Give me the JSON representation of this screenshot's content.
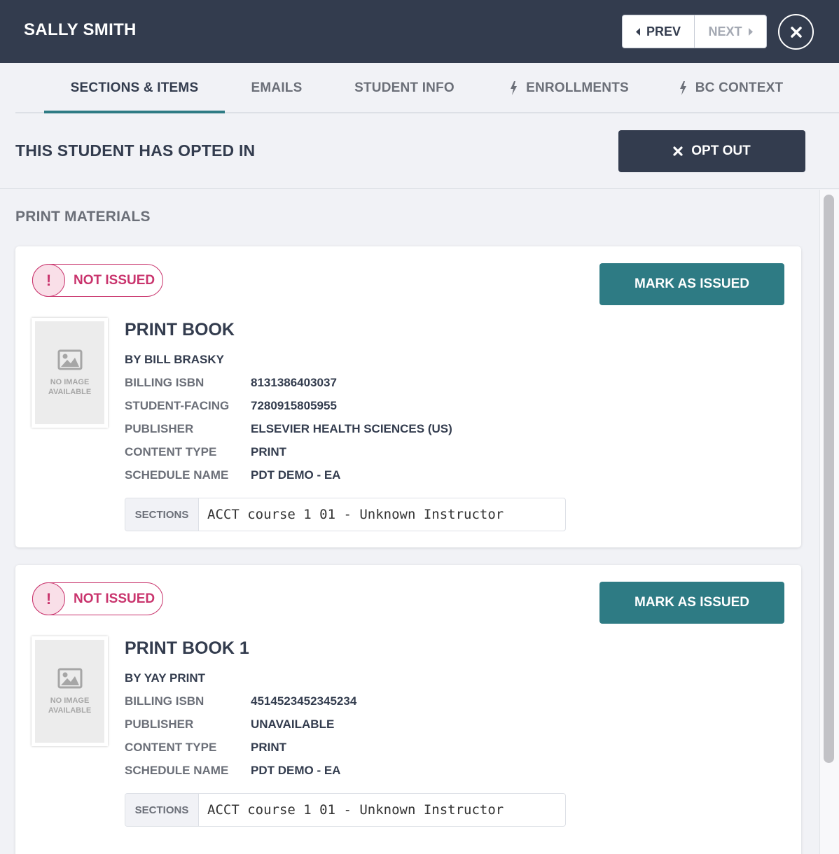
{
  "header": {
    "student_name": "SALLY SMITH",
    "prev_label": "PREV",
    "next_label": "NEXT"
  },
  "tabs": [
    {
      "label": "SECTIONS & ITEMS",
      "active": true
    },
    {
      "label": "EMAILS"
    },
    {
      "label": "STUDENT INFO"
    },
    {
      "label": "ENROLLMENTS",
      "icon": "lightning-icon"
    },
    {
      "label": "BC CONTEXT",
      "icon": "lightning-icon"
    }
  ],
  "opt_status": {
    "message": "THIS STUDENT HAS OPTED IN",
    "button_label": "OPT OUT"
  },
  "print_materials": {
    "title": "PRINT MATERIALS",
    "items": [
      {
        "status": "NOT ISSUED",
        "status_icon": "!",
        "action_label": "MARK AS ISSUED",
        "no_image_text": "NO IMAGE AVAILABLE",
        "title": "PRINT BOOK",
        "author": "BY BILL BRASKY",
        "details": [
          {
            "label": "BILLING ISBN",
            "value": "8131386403037"
          },
          {
            "label": "STUDENT-FACING",
            "value": "7280915805955"
          },
          {
            "label": "PUBLISHER",
            "value": "ELSEVIER HEALTH SCIENCES (US)"
          },
          {
            "label": "CONTENT TYPE",
            "value": "PRINT"
          },
          {
            "label": "SCHEDULE NAME",
            "value": "PDT DEMO - EA"
          }
        ],
        "sections_label": "SECTIONS",
        "sections_value": "ACCT course 1 01 - Unknown Instructor"
      },
      {
        "status": "NOT ISSUED",
        "status_icon": "!",
        "action_label": "MARK AS ISSUED",
        "no_image_text": "NO IMAGE AVAILABLE",
        "title": "PRINT BOOK 1",
        "author": "BY YAY PRINT",
        "details": [
          {
            "label": "BILLING ISBN",
            "value": "4514523452345234"
          },
          {
            "label": "PUBLISHER",
            "value": "UNAVAILABLE"
          },
          {
            "label": "CONTENT TYPE",
            "value": "PRINT"
          },
          {
            "label": "SCHEDULE NAME",
            "value": "PDT DEMO - EA"
          }
        ],
        "sections_label": "SECTIONS",
        "sections_value": "ACCT course 1 01 - Unknown Instructor"
      }
    ]
  },
  "colors": {
    "header_bg": "#333c4e",
    "accent": "#2e7b84",
    "alert": "#c9346d",
    "page_bg": "#f1f2f6"
  }
}
